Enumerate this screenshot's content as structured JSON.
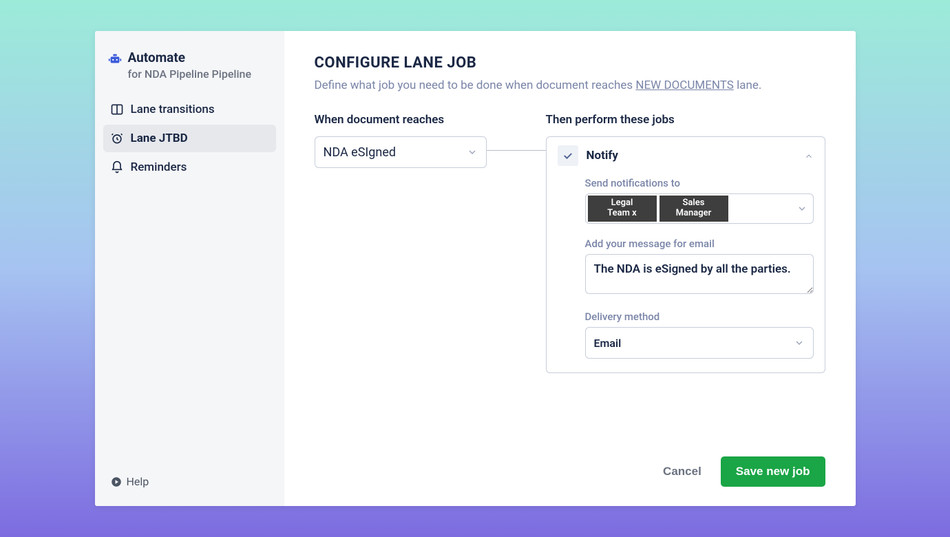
{
  "sidebar": {
    "title": "Automate",
    "subtitle": "for NDA Pipeline Pipeline",
    "nav": [
      {
        "label": "Lane transitions"
      },
      {
        "label": "Lane JTBD"
      },
      {
        "label": "Reminders"
      }
    ],
    "help": "Help"
  },
  "main": {
    "title": "CONFIGURE LANE JOB",
    "desc_prefix": "Define what job you need to be done when document reaches ",
    "lane_name": "NEW DOCUMENTS",
    "desc_suffix": " lane.",
    "when_label": "When document reaches",
    "when_value": "NDA eSIgned",
    "then_label": "Then perform these jobs",
    "job": {
      "title": "Notify",
      "recipients_label": "Send notifications to",
      "recipients": [
        "Legal\nTeam x",
        "Sales\nManager"
      ],
      "message_label": "Add your message for email",
      "message_value": "The NDA is eSigned by all the parties.",
      "delivery_label": "Delivery method",
      "delivery_value": "Email"
    }
  },
  "footer": {
    "cancel": "Cancel",
    "save": "Save new job"
  },
  "colors": {
    "accent": "#3b5bdb",
    "save": "#1aa546"
  }
}
